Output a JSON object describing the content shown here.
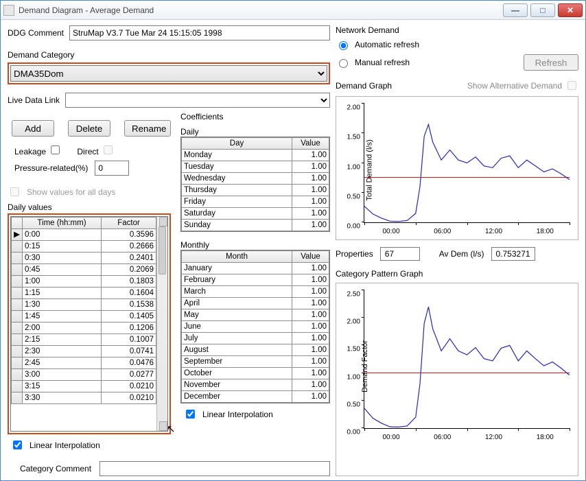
{
  "window": {
    "title": "Demand Diagram - Average Demand"
  },
  "ddg": {
    "label": "DDG Comment",
    "value": "StruMap V3.7 Tue Mar 24 15:15:05 1998"
  },
  "category": {
    "label": "Demand Category",
    "selected": "DMA35Dom"
  },
  "livedata": {
    "label": "Live Data Link",
    "selected": ""
  },
  "buttons": {
    "add": "Add",
    "delete": "Delete",
    "rename": "Rename",
    "refresh": "Refresh"
  },
  "checks": {
    "leakage": "Leakage",
    "direct": "Direct",
    "pressure_label": "Pressure-related(%)",
    "pressure_value": "0",
    "showall": "Show values for all days",
    "linear": "Linear Interpolation",
    "linear2": "Linear Interpolation"
  },
  "dailyvalues": {
    "title": "Daily values",
    "headers": {
      "time": "Time (hh:mm)",
      "factor": "Factor"
    },
    "rows": [
      {
        "t": "0:00",
        "f": "0.3596"
      },
      {
        "t": "0:15",
        "f": "0.2666"
      },
      {
        "t": "0:30",
        "f": "0.2401"
      },
      {
        "t": "0:45",
        "f": "0.2069"
      },
      {
        "t": "1:00",
        "f": "0.1803"
      },
      {
        "t": "1:15",
        "f": "0.1604"
      },
      {
        "t": "1:30",
        "f": "0.1538"
      },
      {
        "t": "1:45",
        "f": "0.1405"
      },
      {
        "t": "2:00",
        "f": "0.1206"
      },
      {
        "t": "2:15",
        "f": "0.1007"
      },
      {
        "t": "2:30",
        "f": "0.0741"
      },
      {
        "t": "2:45",
        "f": "0.0476"
      },
      {
        "t": "3:00",
        "f": "0.0277"
      },
      {
        "t": "3:15",
        "f": "0.0210"
      },
      {
        "t": "3:30",
        "f": "0.0210"
      }
    ]
  },
  "coeffs": {
    "title": "Coefficients",
    "daily_label": "Daily",
    "daily_headers": {
      "day": "Day",
      "value": "Value"
    },
    "daily": [
      {
        "d": "Monday",
        "v": "1.00"
      },
      {
        "d": "Tuesday",
        "v": "1.00"
      },
      {
        "d": "Wednesday",
        "v": "1.00"
      },
      {
        "d": "Thursday",
        "v": "1.00"
      },
      {
        "d": "Friday",
        "v": "1.00"
      },
      {
        "d": "Saturday",
        "v": "1.00"
      },
      {
        "d": "Sunday",
        "v": "1.00"
      }
    ],
    "monthly_label": "Monthly",
    "monthly_headers": {
      "month": "Month",
      "value": "Value"
    },
    "monthly": [
      {
        "m": "January",
        "v": "1.00"
      },
      {
        "m": "February",
        "v": "1.00"
      },
      {
        "m": "March",
        "v": "1.00"
      },
      {
        "m": "April",
        "v": "1.00"
      },
      {
        "m": "May",
        "v": "1.00"
      },
      {
        "m": "June",
        "v": "1.00"
      },
      {
        "m": "July",
        "v": "1.00"
      },
      {
        "m": "August",
        "v": "1.00"
      },
      {
        "m": "September",
        "v": "1.00"
      },
      {
        "m": "October",
        "v": "1.00"
      },
      {
        "m": "November",
        "v": "1.00"
      },
      {
        "m": "December",
        "v": "1.00"
      }
    ]
  },
  "catcomment": {
    "label": "Category Comment",
    "value": ""
  },
  "network": {
    "title": "Network Demand",
    "auto": "Automatic refresh",
    "manual": "Manual refresh"
  },
  "demandgraph": {
    "title": "Demand Graph",
    "showalt": "Show Alternative Demand",
    "ylabel": "Total Demand (l/s)",
    "yticks": [
      "0.00",
      "0.50",
      "1.00",
      "1.50",
      "2.00"
    ],
    "xticks": [
      "00:00",
      "06:00",
      "12:00",
      "18:00",
      "00:00"
    ]
  },
  "props": {
    "label": "Properties",
    "value": "67",
    "avdem_label": "Av Dem (l/s)",
    "avdem_value": "0.753271"
  },
  "catgraph": {
    "title": "Category Pattern Graph",
    "ylabel": "Demand Factor",
    "yticks": [
      "0.00",
      "0.50",
      "1.00",
      "1.50",
      "2.00",
      "2.50"
    ],
    "xticks": [
      "00:00",
      "06:00",
      "12:00",
      "18:00",
      "00:00"
    ]
  },
  "chart_data": [
    {
      "type": "line",
      "title": "Demand Graph",
      "ylabel": "Total Demand (l/s)",
      "ylim": [
        0,
        2.0
      ],
      "x": [
        "00:00",
        "06:00",
        "12:00",
        "18:00",
        "00:00"
      ],
      "reference_line": 0.753271,
      "series": [
        {
          "name": "Total Demand",
          "points_hourfrac": [
            0,
            1,
            2,
            3,
            4,
            5,
            6,
            6.5,
            7,
            7.5,
            8,
            9,
            10,
            11,
            12,
            13,
            14,
            15,
            16,
            17,
            18,
            19,
            20,
            21,
            22,
            23,
            24
          ],
          "values": [
            0.27,
            0.14,
            0.07,
            0.02,
            0.015,
            0.03,
            0.15,
            0.6,
            1.45,
            1.65,
            1.35,
            1.05,
            1.22,
            1.05,
            1.0,
            1.1,
            0.95,
            0.92,
            1.08,
            1.12,
            0.92,
            1.05,
            0.95,
            0.85,
            0.9,
            0.82,
            0.72
          ]
        }
      ]
    },
    {
      "type": "line",
      "title": "Category Pattern Graph",
      "ylabel": "Demand Factor",
      "ylim": [
        0,
        2.5
      ],
      "x": [
        "00:00",
        "06:00",
        "12:00",
        "18:00",
        "00:00"
      ],
      "reference_line": 1.0,
      "series": [
        {
          "name": "Demand Factor",
          "points_hourfrac": [
            0,
            1,
            2,
            3,
            4,
            5,
            6,
            6.5,
            7,
            7.5,
            8,
            9,
            10,
            11,
            12,
            13,
            14,
            15,
            16,
            17,
            18,
            19,
            20,
            21,
            22,
            23,
            24
          ],
          "values": [
            0.36,
            0.18,
            0.09,
            0.025,
            0.02,
            0.04,
            0.2,
            0.8,
            1.9,
            2.2,
            1.8,
            1.4,
            1.62,
            1.4,
            1.33,
            1.46,
            1.26,
            1.22,
            1.45,
            1.5,
            1.22,
            1.4,
            1.26,
            1.13,
            1.2,
            1.09,
            0.96
          ]
        }
      ]
    }
  ]
}
